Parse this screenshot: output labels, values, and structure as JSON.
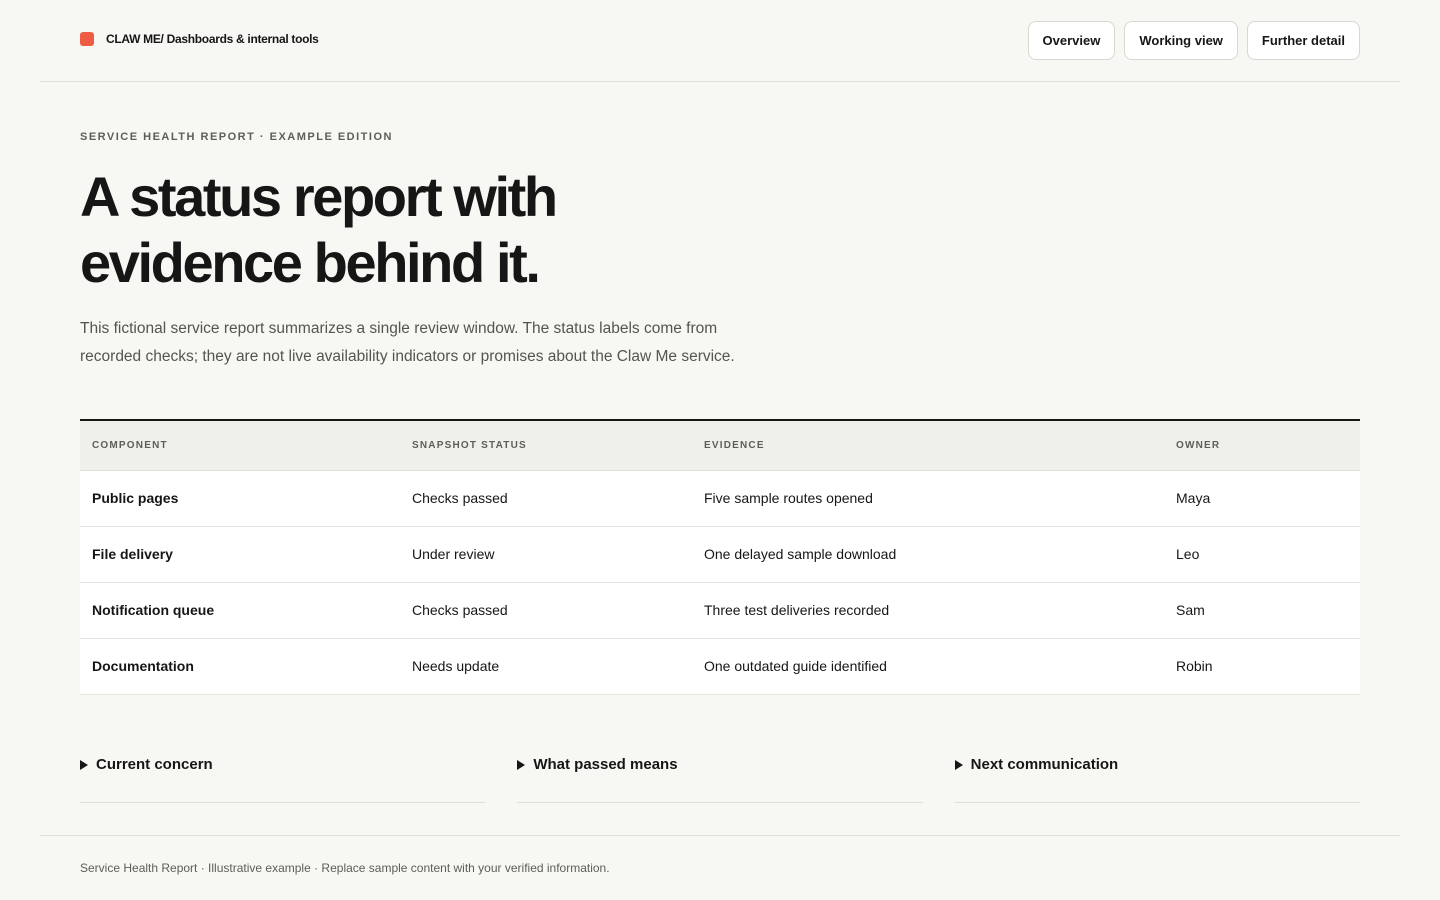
{
  "header": {
    "brand": "CLAW ME/ Dashboards & internal tools",
    "nav": [
      "Overview",
      "Working view",
      "Further detail"
    ]
  },
  "hero": {
    "eyebrow": "SERVICE HEALTH REPORT · EXAMPLE EDITION",
    "title_line1": "A status report with",
    "title_line2": "evidence behind it.",
    "lead_line1": "This fictional service report summarizes a single review window. The status labels come from",
    "lead_line2": "recorded checks; they are not live availability indicators or promises about the Claw Me service."
  },
  "table": {
    "columns": [
      "COMPONENT",
      "SNAPSHOT STATUS",
      "EVIDENCE",
      "OWNER"
    ],
    "rows": [
      [
        "Public pages",
        "Checks passed",
        "Five sample routes opened",
        "Maya"
      ],
      [
        "File delivery",
        "Under review",
        "One delayed sample download",
        "Leo"
      ],
      [
        "Notification queue",
        "Checks passed",
        "Three test deliveries recorded",
        "Sam"
      ],
      [
        "Documentation",
        "Needs update",
        "One outdated guide identified",
        "Robin"
      ]
    ]
  },
  "disclosures": [
    "Current concern",
    "What passed means",
    "Next communication"
  ],
  "footer": {
    "text": "Service Health Report · Illustrative example · Replace sample content with your verified information."
  },
  "colors": {
    "brand_mark": "#ee5c43",
    "background": "#f7f7f3",
    "text": "#161616"
  }
}
